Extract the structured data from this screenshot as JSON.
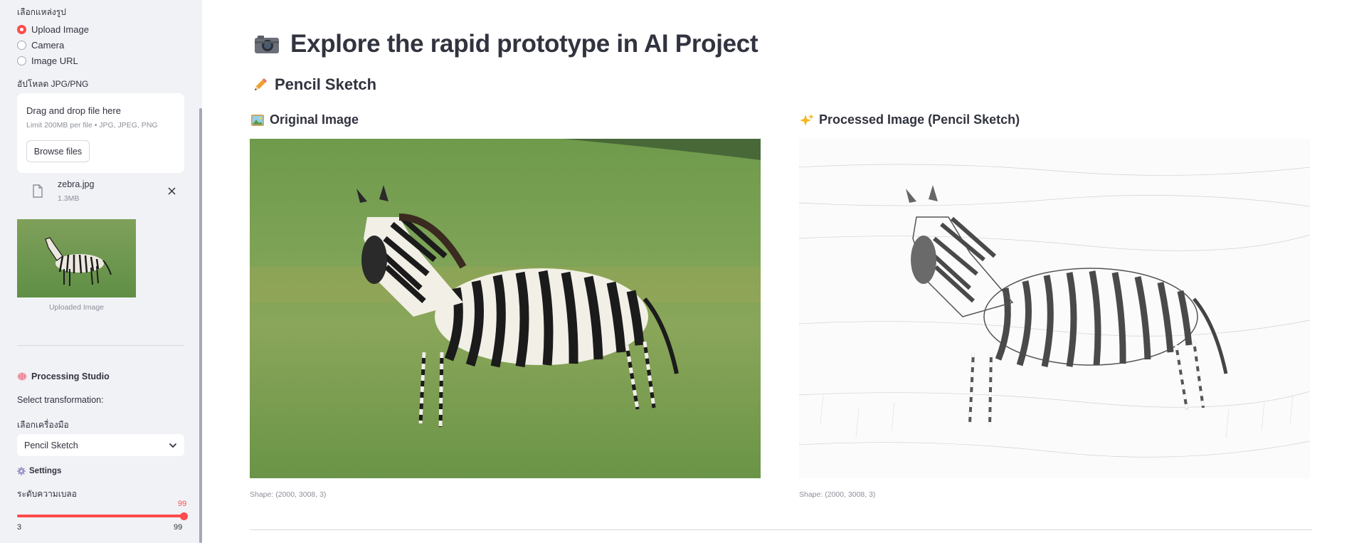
{
  "sidebar": {
    "source_label": "เลือกแหล่งรูป",
    "source_options": [
      {
        "label": "Upload Image",
        "selected": true
      },
      {
        "label": "Camera",
        "selected": false
      },
      {
        "label": "Image URL",
        "selected": false
      }
    ],
    "upload_label": "อัปโหลด JPG/PNG",
    "uploader": {
      "title": "Drag and drop file here",
      "limit": "Limit 200MB per file • JPG, JPEG, PNG",
      "browse_label": "Browse files"
    },
    "file": {
      "name": "zebra.jpg",
      "size": "1.3MB"
    },
    "thumbnail_caption": "Uploaded Image",
    "studio_title": "Processing Studio",
    "select_transformation": "Select transformation:",
    "tool_label": "เลือกเครื่องมือ",
    "tool_selected": "Pencil Sketch",
    "settings_title": "Settings",
    "blur_label": "ระดับความเบลอ",
    "slider": {
      "value": "99",
      "min": "3",
      "max": "99",
      "fraction": 1.0
    }
  },
  "main": {
    "title_icon": "📷",
    "title": "Explore the rapid prototype in AI Project",
    "subtitle_icon": "✏️",
    "subtitle": "Pencil Sketch",
    "original": {
      "icon": "🖼️",
      "title": "Original Image",
      "shape": "Shape: (2000, 3008, 3)"
    },
    "processed": {
      "icon": "✨",
      "title": "Processed Image (Pencil Sketch)",
      "shape": "Shape: (2000, 3008, 3)"
    }
  },
  "colors": {
    "accent": "#ff4b4b",
    "sidebar_bg": "#f0f2f6",
    "text": "#31333f",
    "muted": "#8c8f99"
  },
  "icons": [
    "file-icon",
    "close-icon",
    "chevron-down-icon",
    "camera-icon",
    "pencil-icon",
    "picture-icon",
    "sparkles-icon",
    "brain-icon",
    "gear-icon"
  ]
}
